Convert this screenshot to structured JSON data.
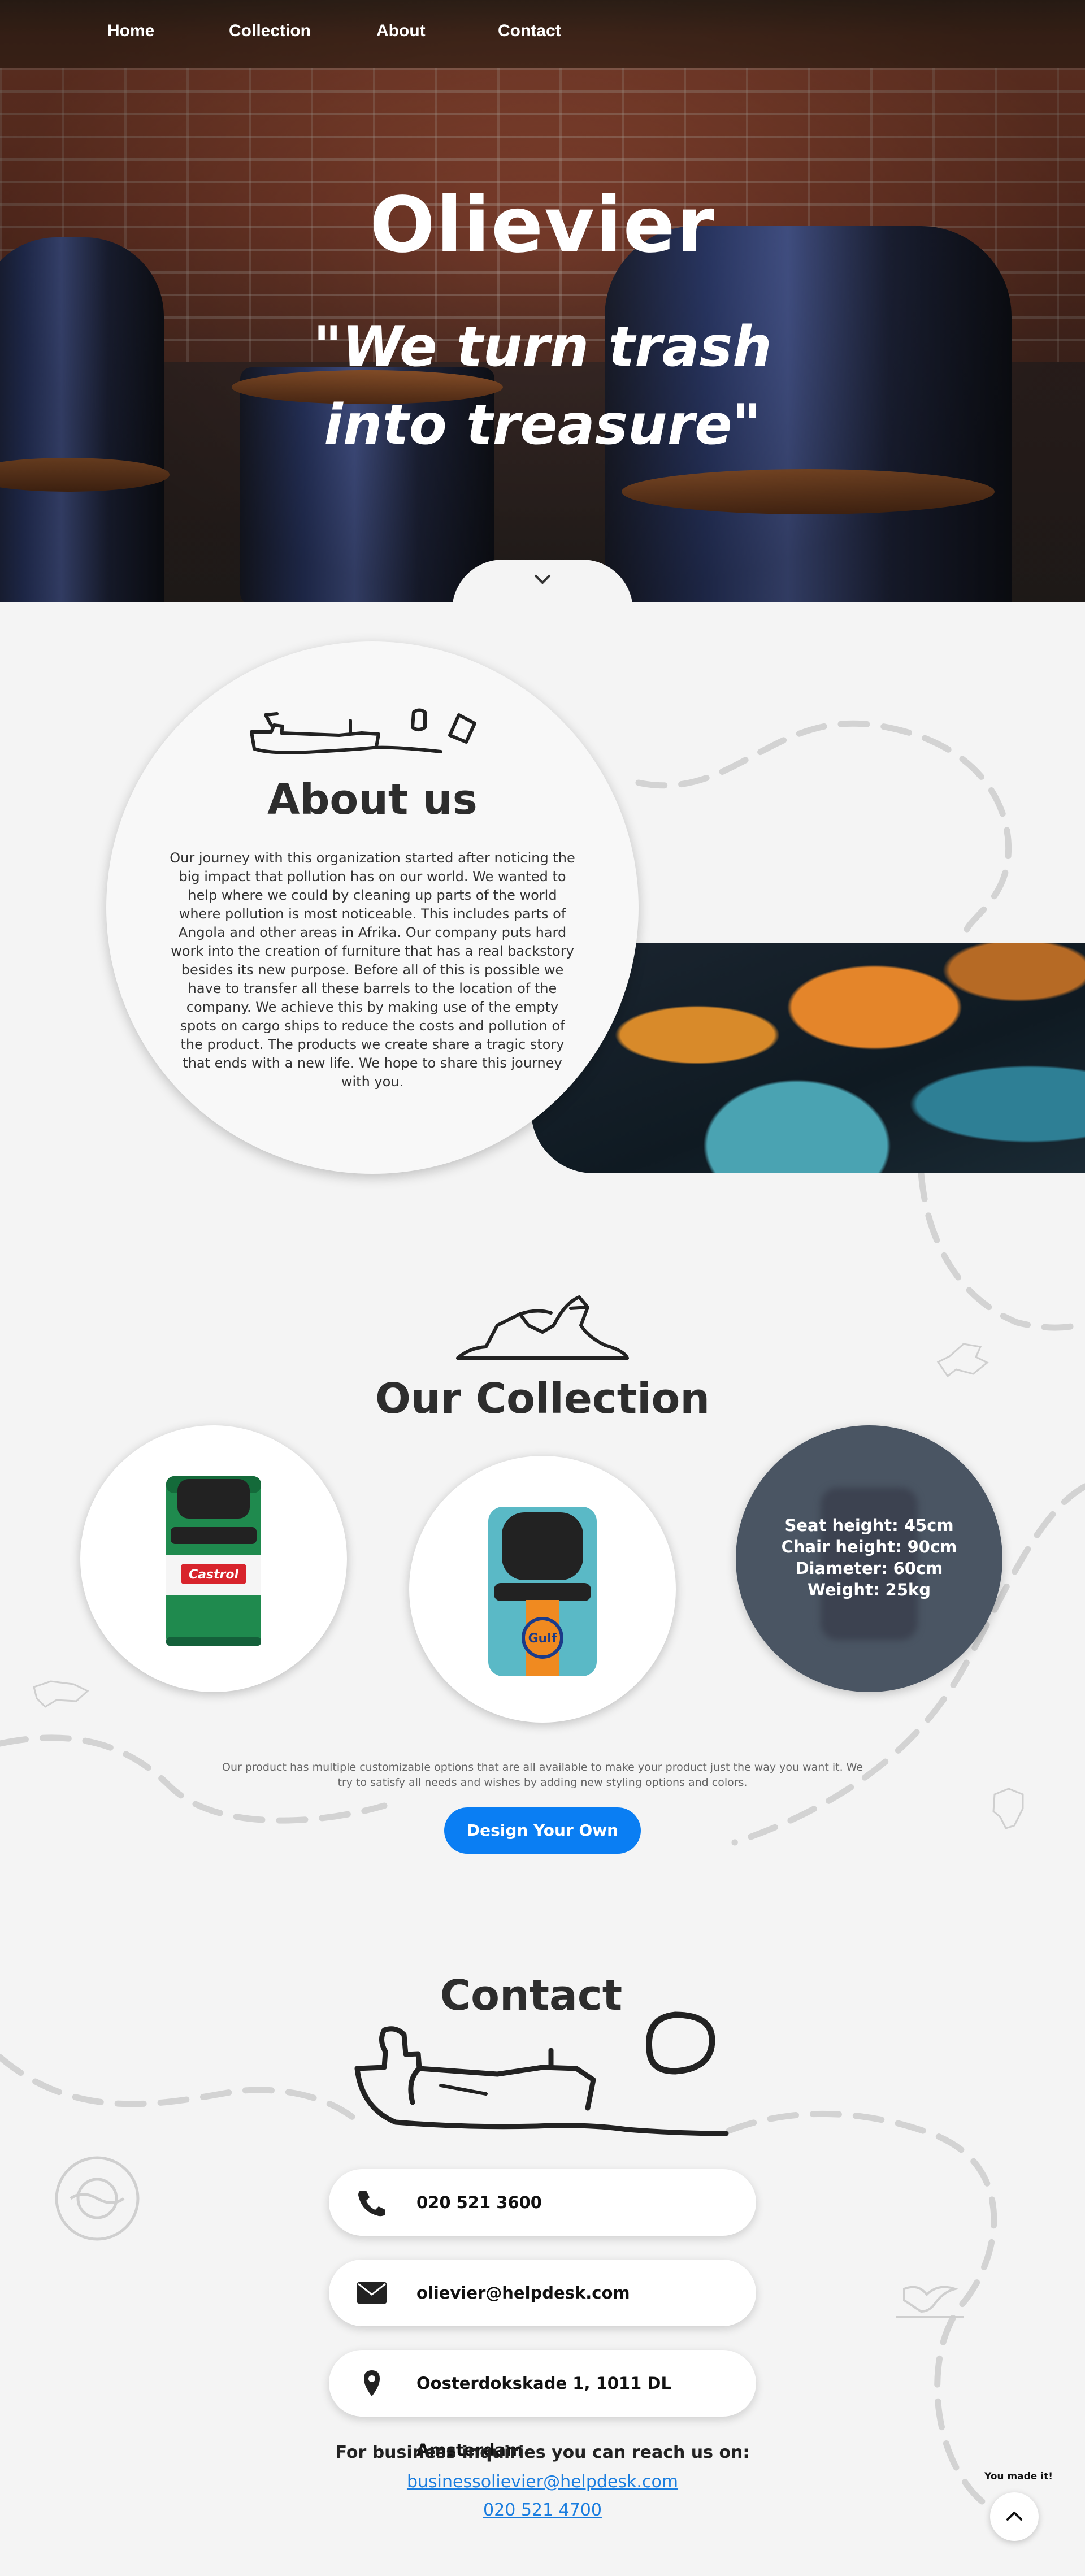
{
  "nav": {
    "items": [
      {
        "label": "Home"
      },
      {
        "label": "Collection"
      },
      {
        "label": "About"
      },
      {
        "label": "Contact"
      }
    ]
  },
  "hero": {
    "title": "Olievier",
    "quote": "\"We turn trash into treasure\""
  },
  "about": {
    "title": "About us",
    "text": "Our journey with this organization started after noticing the big impact that pollution has on our world. We wanted to help where we could by cleaning up parts of the world where pollution is most noticeable. This includes parts of Angola and other areas in Afrika. Our company puts hard work into the creation of furniture that has a real backstory besides its new purpose. Before all of this is possible we have to transfer all these barrels to the location of the company. We achieve this by making use of the empty spots on cargo ships to reduce the costs and pollution of the product. The products we create share a tragic story that ends with a new life. We hope to share this journey with you."
  },
  "collection": {
    "title": "Our Collection",
    "products": [
      {
        "brand_label": "Castrol",
        "color": "#1f8a4e"
      },
      {
        "brand_label": "Gulf",
        "color": "#5ab9c6"
      }
    ],
    "specs": {
      "seat_height": "Seat height: 45cm",
      "chair_height": "Chair height: 90cm",
      "diameter": "Diameter: 60cm",
      "weight": "Weight: 25kg"
    },
    "description": "Our product has multiple customizable options that are all available to make your product just the way you want it. We try to satisfy all needs and wishes by adding new styling options and colors.",
    "button_label": "Design Your Own"
  },
  "contact": {
    "title": "Contact",
    "phone": "020 521 3600",
    "email": "olievier@helpdesk.com",
    "address": "Oosterdokskade 1, 1011 DL Amsterdam",
    "business_label": "For business inquiries you can reach us on:",
    "business_email": "businessolievier@helpdesk.com",
    "business_phone": "020 521 4700"
  },
  "footer": {
    "made_it": "You made it!"
  },
  "colors": {
    "accent": "#0a7ef3",
    "link": "#1a7ddf",
    "background": "#f4f4f4",
    "spec_circle": "#4a5563"
  }
}
